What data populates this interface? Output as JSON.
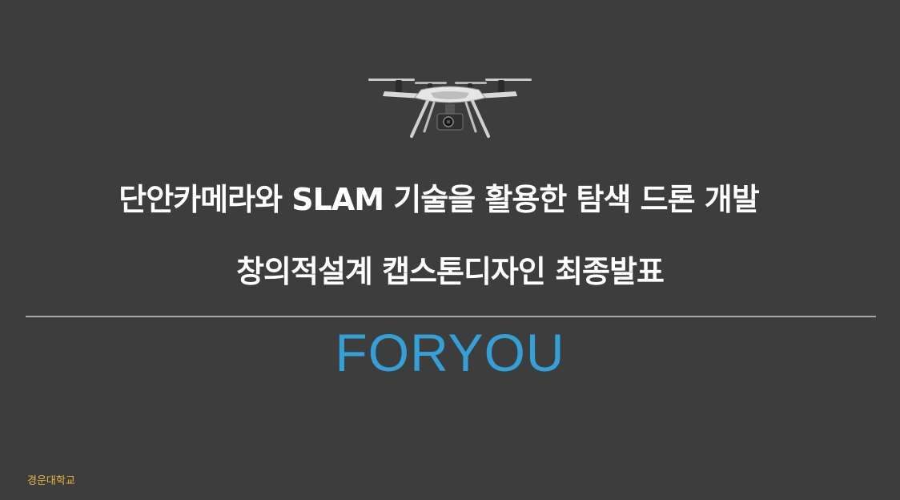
{
  "slide": {
    "title_line_1": "단안카메라와 SLAM 기술을 활용한 탐색 드론 개발",
    "title_line_2": "창의적설계 캡스톤디자인 최종발표",
    "team_name": "FORYOU",
    "university": "경운대학교"
  },
  "colors": {
    "background": "#3d3d3d",
    "title": "#ffffff",
    "team_name": "#33a0d8",
    "university": "#e7b93c",
    "divider": "#a8a8a8"
  },
  "images": {
    "drone": "drone-icon"
  }
}
